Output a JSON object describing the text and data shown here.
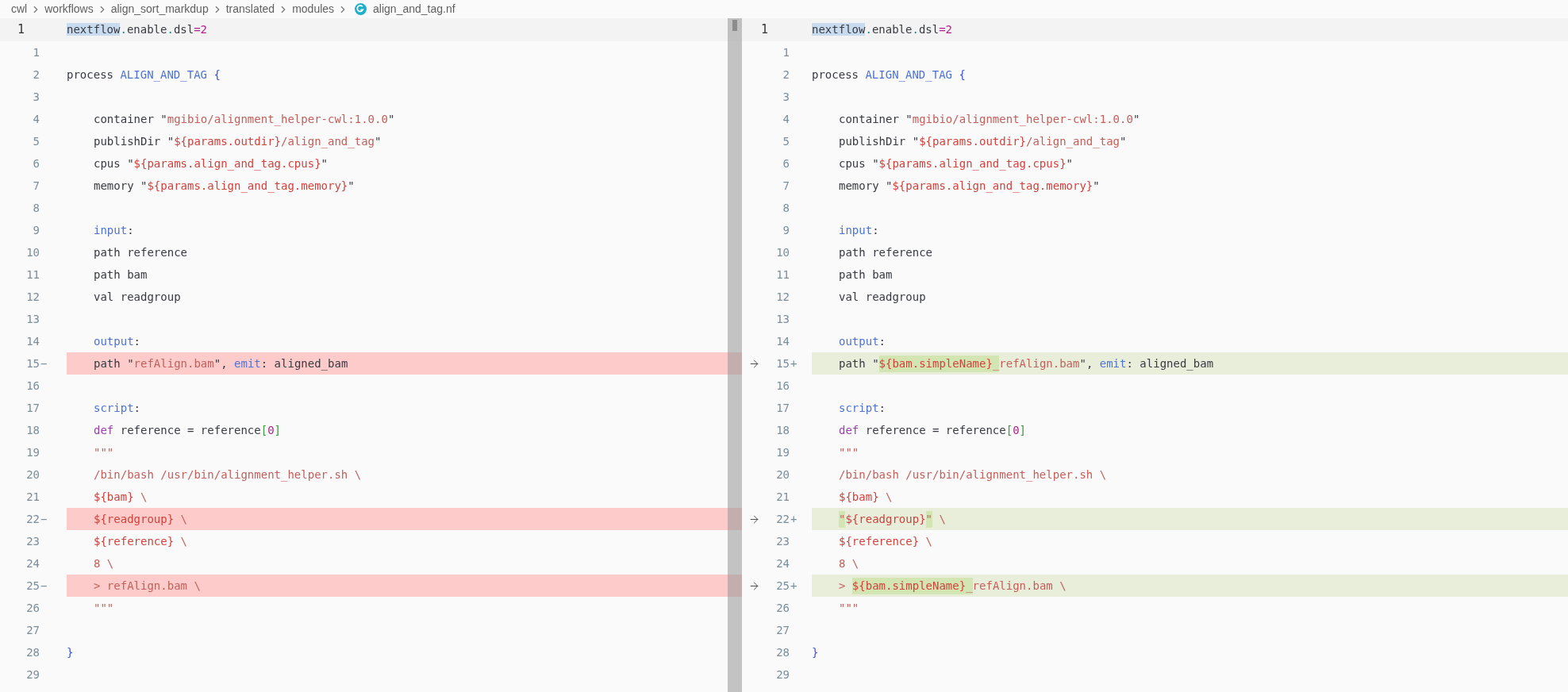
{
  "breadcrumb": {
    "items": [
      "cwl",
      "workflows",
      "align_sort_markdup",
      "translated",
      "modules"
    ],
    "file": "align_and_tag.nf"
  },
  "panes": [
    {
      "sticky": {
        "number": "1",
        "tokens": [
          {
            "t": "nextflow",
            "kind": "selection"
          },
          {
            "t": ".",
            "kind": "dot"
          },
          {
            "t": "enable",
            "kind": "plain"
          },
          {
            "t": ".",
            "kind": "dot"
          },
          {
            "t": "dsl",
            "kind": "plain"
          },
          {
            "t": "=2",
            "kind": "number"
          }
        ]
      },
      "lines": [
        {
          "number": "1",
          "kind": "normal"
        },
        {
          "number": "2",
          "kind": "normal",
          "indented": false,
          "tokens": [
            {
              "t": "process ",
              "kind": "plain"
            },
            {
              "t": "ALIGN_AND_TAG",
              "kind": "keyword"
            },
            {
              "t": " {",
              "kind": "brace"
            }
          ]
        },
        {
          "number": "3",
          "kind": "normal"
        },
        {
          "number": "4",
          "kind": "normal",
          "indented": true,
          "tokens": [
            {
              "t": "container \"",
              "kind": "plain"
            },
            {
              "t": "mgibio/alignment_helper-cwl:1.0.0",
              "kind": "string"
            },
            {
              "t": "\"",
              "kind": "plain"
            }
          ]
        },
        {
          "number": "5",
          "kind": "normal",
          "indented": true,
          "tokens": [
            {
              "t": "publishDir \"",
              "kind": "plain"
            },
            {
              "t": "${params.outdir}",
              "kind": "interpolation"
            },
            {
              "t": "/align_and_tag",
              "kind": "string"
            },
            {
              "t": "\"",
              "kind": "plain"
            }
          ]
        },
        {
          "number": "6",
          "kind": "normal",
          "indented": true,
          "tokens": [
            {
              "t": "cpus \"",
              "kind": "plain"
            },
            {
              "t": "${params.align_and_tag.cpus}",
              "kind": "interpolation"
            },
            {
              "t": "\"",
              "kind": "plain"
            }
          ]
        },
        {
          "number": "7",
          "kind": "normal",
          "indented": true,
          "tokens": [
            {
              "t": "memory \"",
              "kind": "plain"
            },
            {
              "t": "${params.align_and_tag.memory}",
              "kind": "interpolation"
            },
            {
              "t": "\"",
              "kind": "plain"
            }
          ]
        },
        {
          "number": "8",
          "kind": "normal"
        },
        {
          "number": "9",
          "kind": "normal",
          "indented": true,
          "tokens": [
            {
              "t": "input",
              "kind": "keyword"
            },
            {
              "t": ":",
              "kind": "plain"
            }
          ]
        },
        {
          "number": "10",
          "kind": "normal",
          "indented": true,
          "tokens": [
            {
              "t": "path reference",
              "kind": "plain"
            }
          ]
        },
        {
          "number": "11",
          "kind": "normal",
          "indented": true,
          "tokens": [
            {
              "t": "path bam",
              "kind": "plain"
            }
          ]
        },
        {
          "number": "12",
          "kind": "normal",
          "indented": true,
          "tokens": [
            {
              "t": "val readgroup",
              "kind": "plain"
            }
          ]
        },
        {
          "number": "13",
          "kind": "normal"
        },
        {
          "number": "14",
          "kind": "normal",
          "indented": true,
          "tokens": [
            {
              "t": "output",
              "kind": "keyword"
            },
            {
              "t": ":",
              "kind": "plain"
            }
          ]
        },
        {
          "number": "15",
          "marker": "−",
          "kind": "removed",
          "indented": true,
          "tokens": [
            {
              "t": "path \"",
              "kind": "plain"
            },
            {
              "t": "refAlign.bam",
              "kind": "string"
            },
            {
              "t": "\", ",
              "kind": "plain"
            },
            {
              "t": "emit",
              "kind": "keyword"
            },
            {
              "t": ": aligned_bam",
              "kind": "plain"
            }
          ]
        },
        {
          "number": "16",
          "kind": "normal"
        },
        {
          "number": "17",
          "kind": "normal",
          "indented": true,
          "tokens": [
            {
              "t": "script",
              "kind": "keyword"
            },
            {
              "t": ":",
              "kind": "plain"
            }
          ]
        },
        {
          "number": "18",
          "kind": "normal",
          "indented": true,
          "tokens": [
            {
              "t": "def",
              "kind": "def"
            },
            {
              "t": " reference = reference",
              "kind": "plain"
            },
            {
              "t": "[",
              "kind": "bracket"
            },
            {
              "t": "0",
              "kind": "number"
            },
            {
              "t": "]",
              "kind": "bracket"
            }
          ]
        },
        {
          "number": "19",
          "kind": "normal",
          "indented": true,
          "tokens": [
            {
              "t": "\"\"\"",
              "kind": "string"
            }
          ]
        },
        {
          "number": "20",
          "kind": "normal",
          "indented": true,
          "tokens": [
            {
              "t": "/bin/bash /usr/bin/alignment_helper.sh \\",
              "kind": "string"
            }
          ]
        },
        {
          "number": "21",
          "kind": "normal",
          "indented": true,
          "tokens": [
            {
              "t": "${bam}",
              "kind": "interpolation"
            },
            {
              "t": " \\",
              "kind": "string"
            }
          ]
        },
        {
          "number": "22",
          "marker": "−",
          "kind": "removed",
          "indented": true,
          "tokens": [
            {
              "t": "${readgroup}",
              "kind": "interpolation"
            },
            {
              "t": " \\",
              "kind": "string"
            }
          ]
        },
        {
          "number": "23",
          "kind": "normal",
          "indented": true,
          "tokens": [
            {
              "t": "${reference}",
              "kind": "interpolation"
            },
            {
              "t": " \\",
              "kind": "string"
            }
          ]
        },
        {
          "number": "24",
          "kind": "normal",
          "indented": true,
          "tokens": [
            {
              "t": "8 \\",
              "kind": "string"
            }
          ]
        },
        {
          "number": "25",
          "marker": "−",
          "kind": "removed",
          "indented": true,
          "tokens": [
            {
              "t": "> refAlign.bam \\",
              "kind": "string"
            }
          ]
        },
        {
          "number": "26",
          "kind": "normal",
          "indented": true,
          "tokens": [
            {
              "t": "\"\"\"",
              "kind": "string"
            }
          ]
        },
        {
          "number": "27",
          "kind": "normal"
        },
        {
          "number": "28",
          "kind": "normal",
          "indented": false,
          "tokens": [
            {
              "t": "}",
              "kind": "brace"
            }
          ]
        },
        {
          "number": "29",
          "kind": "normal"
        }
      ]
    },
    {
      "sticky": {
        "number": "1",
        "tokens": [
          {
            "t": "nextflow",
            "kind": "selection"
          },
          {
            "t": ".",
            "kind": "dot"
          },
          {
            "t": "enable",
            "kind": "plain"
          },
          {
            "t": ".",
            "kind": "dot"
          },
          {
            "t": "dsl",
            "kind": "plain"
          },
          {
            "t": "=2",
            "kind": "number"
          }
        ]
      },
      "lines": [
        {
          "number": "1",
          "kind": "normal"
        },
        {
          "number": "2",
          "kind": "normal",
          "indented": false,
          "tokens": [
            {
              "t": "process ",
              "kind": "plain"
            },
            {
              "t": "ALIGN_AND_TAG",
              "kind": "keyword"
            },
            {
              "t": " {",
              "kind": "brace"
            }
          ]
        },
        {
          "number": "3",
          "kind": "normal"
        },
        {
          "number": "4",
          "kind": "normal",
          "indented": true,
          "tokens": [
            {
              "t": "container \"",
              "kind": "plain"
            },
            {
              "t": "mgibio/alignment_helper-cwl:1.0.0",
              "kind": "string"
            },
            {
              "t": "\"",
              "kind": "plain"
            }
          ]
        },
        {
          "number": "5",
          "kind": "normal",
          "indented": true,
          "tokens": [
            {
              "t": "publishDir \"",
              "kind": "plain"
            },
            {
              "t": "${params.outdir}",
              "kind": "interpolation"
            },
            {
              "t": "/align_and_tag",
              "kind": "string"
            },
            {
              "t": "\"",
              "kind": "plain"
            }
          ]
        },
        {
          "number": "6",
          "kind": "normal",
          "indented": true,
          "tokens": [
            {
              "t": "cpus \"",
              "kind": "plain"
            },
            {
              "t": "${params.align_and_tag.cpus}",
              "kind": "interpolation"
            },
            {
              "t": "\"",
              "kind": "plain"
            }
          ]
        },
        {
          "number": "7",
          "kind": "normal",
          "indented": true,
          "tokens": [
            {
              "t": "memory \"",
              "kind": "plain"
            },
            {
              "t": "${params.align_and_tag.memory}",
              "kind": "interpolation"
            },
            {
              "t": "\"",
              "kind": "plain"
            }
          ]
        },
        {
          "number": "8",
          "kind": "normal"
        },
        {
          "number": "9",
          "kind": "normal",
          "indented": true,
          "tokens": [
            {
              "t": "input",
              "kind": "keyword"
            },
            {
              "t": ":",
              "kind": "plain"
            }
          ]
        },
        {
          "number": "10",
          "kind": "normal",
          "indented": true,
          "tokens": [
            {
              "t": "path reference",
              "kind": "plain"
            }
          ]
        },
        {
          "number": "11",
          "kind": "normal",
          "indented": true,
          "tokens": [
            {
              "t": "path bam",
              "kind": "plain"
            }
          ]
        },
        {
          "number": "12",
          "kind": "normal",
          "indented": true,
          "tokens": [
            {
              "t": "val readgroup",
              "kind": "plain"
            }
          ]
        },
        {
          "number": "13",
          "kind": "normal"
        },
        {
          "number": "14",
          "kind": "normal",
          "indented": true,
          "tokens": [
            {
              "t": "output",
              "kind": "keyword"
            },
            {
              "t": ":",
              "kind": "plain"
            }
          ]
        },
        {
          "number": "15",
          "marker": "+",
          "kind": "added",
          "indented": true,
          "tokens": [
            {
              "t": "path \"",
              "kind": "plain",
              "changed": false
            },
            {
              "t": "${bam.simpleName}",
              "kind": "interpolation",
              "changed": true
            },
            {
              "t": "_",
              "kind": "string",
              "changed": true
            },
            {
              "t": "refAlign.bam",
              "kind": "string",
              "changed": false
            },
            {
              "t": "\", ",
              "kind": "plain",
              "changed": false
            },
            {
              "t": "emit",
              "kind": "keyword",
              "changed": false
            },
            {
              "t": ": aligned_bam",
              "kind": "plain",
              "changed": false
            }
          ]
        },
        {
          "number": "16",
          "kind": "normal"
        },
        {
          "number": "17",
          "kind": "normal",
          "indented": true,
          "tokens": [
            {
              "t": "script",
              "kind": "keyword"
            },
            {
              "t": ":",
              "kind": "plain"
            }
          ]
        },
        {
          "number": "18",
          "kind": "normal",
          "indented": true,
          "tokens": [
            {
              "t": "def",
              "kind": "def"
            },
            {
              "t": " reference = reference",
              "kind": "plain"
            },
            {
              "t": "[",
              "kind": "bracket"
            },
            {
              "t": "0",
              "kind": "number"
            },
            {
              "t": "]",
              "kind": "bracket"
            }
          ]
        },
        {
          "number": "19",
          "kind": "normal",
          "indented": true,
          "tokens": [
            {
              "t": "\"\"\"",
              "kind": "string"
            }
          ]
        },
        {
          "number": "20",
          "kind": "normal",
          "indented": true,
          "tokens": [
            {
              "t": "/bin/bash /usr/bin/alignment_helper.sh \\",
              "kind": "string"
            }
          ]
        },
        {
          "number": "21",
          "kind": "normal",
          "indented": true,
          "tokens": [
            {
              "t": "${bam}",
              "kind": "interpolation"
            },
            {
              "t": " \\",
              "kind": "string"
            }
          ]
        },
        {
          "number": "22",
          "marker": "+",
          "kind": "added",
          "indented": true,
          "tokens": [
            {
              "t": "\"",
              "kind": "string",
              "changed": true
            },
            {
              "t": "${readgroup}",
              "kind": "interpolation",
              "changed": false
            },
            {
              "t": "\"",
              "kind": "string",
              "changed": true
            },
            {
              "t": " \\",
              "kind": "string",
              "changed": false
            }
          ]
        },
        {
          "number": "23",
          "kind": "normal",
          "indented": true,
          "tokens": [
            {
              "t": "${reference}",
              "kind": "interpolation"
            },
            {
              "t": " \\",
              "kind": "string"
            }
          ]
        },
        {
          "number": "24",
          "kind": "normal",
          "indented": true,
          "tokens": [
            {
              "t": "8 \\",
              "kind": "string"
            }
          ]
        },
        {
          "number": "25",
          "marker": "+",
          "kind": "added",
          "indented": true,
          "tokens": [
            {
              "t": "> ",
              "kind": "string",
              "changed": false
            },
            {
              "t": "${bam.simpleName}",
              "kind": "interpolation",
              "changed": true
            },
            {
              "t": "_",
              "kind": "string",
              "changed": true
            },
            {
              "t": "refAlign.bam \\",
              "kind": "string",
              "changed": false
            }
          ]
        },
        {
          "number": "26",
          "kind": "normal",
          "indented": true,
          "tokens": [
            {
              "t": "\"\"\"",
              "kind": "string"
            }
          ]
        },
        {
          "number": "27",
          "kind": "normal"
        },
        {
          "number": "28",
          "kind": "normal",
          "indented": false,
          "tokens": [
            {
              "t": "}",
              "kind": "brace"
            }
          ]
        },
        {
          "number": "29",
          "kind": "normal"
        }
      ]
    }
  ]
}
